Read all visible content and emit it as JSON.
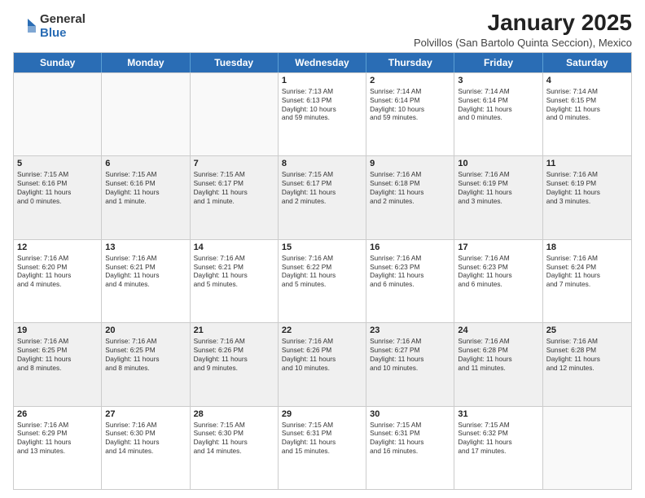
{
  "logo": {
    "general": "General",
    "blue": "Blue"
  },
  "title": "January 2025",
  "subtitle": "Polvillos (San Bartolo Quinta Seccion), Mexico",
  "header_days": [
    "Sunday",
    "Monday",
    "Tuesday",
    "Wednesday",
    "Thursday",
    "Friday",
    "Saturday"
  ],
  "weeks": [
    [
      {
        "day": "",
        "lines": [],
        "shaded": false
      },
      {
        "day": "",
        "lines": [],
        "shaded": false
      },
      {
        "day": "",
        "lines": [],
        "shaded": false
      },
      {
        "day": "1",
        "lines": [
          "Sunrise: 7:13 AM",
          "Sunset: 6:13 PM",
          "Daylight: 10 hours",
          "and 59 minutes."
        ],
        "shaded": false
      },
      {
        "day": "2",
        "lines": [
          "Sunrise: 7:14 AM",
          "Sunset: 6:14 PM",
          "Daylight: 10 hours",
          "and 59 minutes."
        ],
        "shaded": false
      },
      {
        "day": "3",
        "lines": [
          "Sunrise: 7:14 AM",
          "Sunset: 6:14 PM",
          "Daylight: 11 hours",
          "and 0 minutes."
        ],
        "shaded": false
      },
      {
        "day": "4",
        "lines": [
          "Sunrise: 7:14 AM",
          "Sunset: 6:15 PM",
          "Daylight: 11 hours",
          "and 0 minutes."
        ],
        "shaded": false
      }
    ],
    [
      {
        "day": "5",
        "lines": [
          "Sunrise: 7:15 AM",
          "Sunset: 6:16 PM",
          "Daylight: 11 hours",
          "and 0 minutes."
        ],
        "shaded": true
      },
      {
        "day": "6",
        "lines": [
          "Sunrise: 7:15 AM",
          "Sunset: 6:16 PM",
          "Daylight: 11 hours",
          "and 1 minute."
        ],
        "shaded": true
      },
      {
        "day": "7",
        "lines": [
          "Sunrise: 7:15 AM",
          "Sunset: 6:17 PM",
          "Daylight: 11 hours",
          "and 1 minute."
        ],
        "shaded": true
      },
      {
        "day": "8",
        "lines": [
          "Sunrise: 7:15 AM",
          "Sunset: 6:17 PM",
          "Daylight: 11 hours",
          "and 2 minutes."
        ],
        "shaded": true
      },
      {
        "day": "9",
        "lines": [
          "Sunrise: 7:16 AM",
          "Sunset: 6:18 PM",
          "Daylight: 11 hours",
          "and 2 minutes."
        ],
        "shaded": true
      },
      {
        "day": "10",
        "lines": [
          "Sunrise: 7:16 AM",
          "Sunset: 6:19 PM",
          "Daylight: 11 hours",
          "and 3 minutes."
        ],
        "shaded": true
      },
      {
        "day": "11",
        "lines": [
          "Sunrise: 7:16 AM",
          "Sunset: 6:19 PM",
          "Daylight: 11 hours",
          "and 3 minutes."
        ],
        "shaded": true
      }
    ],
    [
      {
        "day": "12",
        "lines": [
          "Sunrise: 7:16 AM",
          "Sunset: 6:20 PM",
          "Daylight: 11 hours",
          "and 4 minutes."
        ],
        "shaded": false
      },
      {
        "day": "13",
        "lines": [
          "Sunrise: 7:16 AM",
          "Sunset: 6:21 PM",
          "Daylight: 11 hours",
          "and 4 minutes."
        ],
        "shaded": false
      },
      {
        "day": "14",
        "lines": [
          "Sunrise: 7:16 AM",
          "Sunset: 6:21 PM",
          "Daylight: 11 hours",
          "and 5 minutes."
        ],
        "shaded": false
      },
      {
        "day": "15",
        "lines": [
          "Sunrise: 7:16 AM",
          "Sunset: 6:22 PM",
          "Daylight: 11 hours",
          "and 5 minutes."
        ],
        "shaded": false
      },
      {
        "day": "16",
        "lines": [
          "Sunrise: 7:16 AM",
          "Sunset: 6:23 PM",
          "Daylight: 11 hours",
          "and 6 minutes."
        ],
        "shaded": false
      },
      {
        "day": "17",
        "lines": [
          "Sunrise: 7:16 AM",
          "Sunset: 6:23 PM",
          "Daylight: 11 hours",
          "and 6 minutes."
        ],
        "shaded": false
      },
      {
        "day": "18",
        "lines": [
          "Sunrise: 7:16 AM",
          "Sunset: 6:24 PM",
          "Daylight: 11 hours",
          "and 7 minutes."
        ],
        "shaded": false
      }
    ],
    [
      {
        "day": "19",
        "lines": [
          "Sunrise: 7:16 AM",
          "Sunset: 6:25 PM",
          "Daylight: 11 hours",
          "and 8 minutes."
        ],
        "shaded": true
      },
      {
        "day": "20",
        "lines": [
          "Sunrise: 7:16 AM",
          "Sunset: 6:25 PM",
          "Daylight: 11 hours",
          "and 8 minutes."
        ],
        "shaded": true
      },
      {
        "day": "21",
        "lines": [
          "Sunrise: 7:16 AM",
          "Sunset: 6:26 PM",
          "Daylight: 11 hours",
          "and 9 minutes."
        ],
        "shaded": true
      },
      {
        "day": "22",
        "lines": [
          "Sunrise: 7:16 AM",
          "Sunset: 6:26 PM",
          "Daylight: 11 hours",
          "and 10 minutes."
        ],
        "shaded": true
      },
      {
        "day": "23",
        "lines": [
          "Sunrise: 7:16 AM",
          "Sunset: 6:27 PM",
          "Daylight: 11 hours",
          "and 10 minutes."
        ],
        "shaded": true
      },
      {
        "day": "24",
        "lines": [
          "Sunrise: 7:16 AM",
          "Sunset: 6:28 PM",
          "Daylight: 11 hours",
          "and 11 minutes."
        ],
        "shaded": true
      },
      {
        "day": "25",
        "lines": [
          "Sunrise: 7:16 AM",
          "Sunset: 6:28 PM",
          "Daylight: 11 hours",
          "and 12 minutes."
        ],
        "shaded": true
      }
    ],
    [
      {
        "day": "26",
        "lines": [
          "Sunrise: 7:16 AM",
          "Sunset: 6:29 PM",
          "Daylight: 11 hours",
          "and 13 minutes."
        ],
        "shaded": false
      },
      {
        "day": "27",
        "lines": [
          "Sunrise: 7:16 AM",
          "Sunset: 6:30 PM",
          "Daylight: 11 hours",
          "and 14 minutes."
        ],
        "shaded": false
      },
      {
        "day": "28",
        "lines": [
          "Sunrise: 7:15 AM",
          "Sunset: 6:30 PM",
          "Daylight: 11 hours",
          "and 14 minutes."
        ],
        "shaded": false
      },
      {
        "day": "29",
        "lines": [
          "Sunrise: 7:15 AM",
          "Sunset: 6:31 PM",
          "Daylight: 11 hours",
          "and 15 minutes."
        ],
        "shaded": false
      },
      {
        "day": "30",
        "lines": [
          "Sunrise: 7:15 AM",
          "Sunset: 6:31 PM",
          "Daylight: 11 hours",
          "and 16 minutes."
        ],
        "shaded": false
      },
      {
        "day": "31",
        "lines": [
          "Sunrise: 7:15 AM",
          "Sunset: 6:32 PM",
          "Daylight: 11 hours",
          "and 17 minutes."
        ],
        "shaded": false
      },
      {
        "day": "",
        "lines": [],
        "shaded": false
      }
    ]
  ]
}
